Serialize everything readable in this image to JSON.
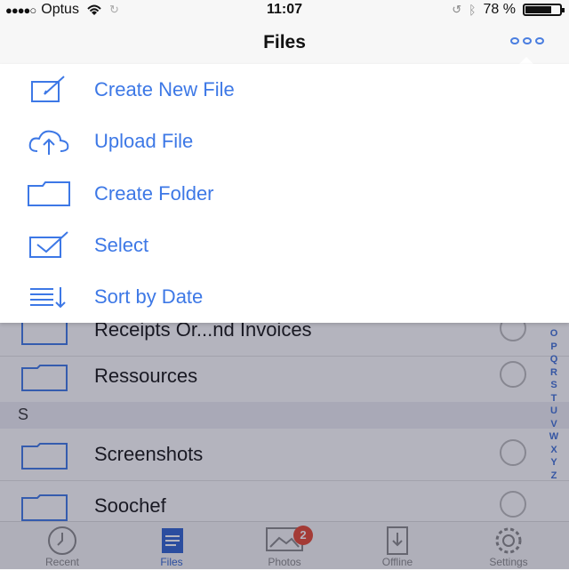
{
  "status_bar": {
    "carrier": "Optus",
    "time": "11:07",
    "battery_text": "78 %",
    "battery_level": 0.78
  },
  "nav": {
    "title": "Files",
    "more_icon": "more-icon"
  },
  "menu": {
    "items": [
      {
        "label": "Create New File",
        "icon": "compose-icon"
      },
      {
        "label": "Upload File",
        "icon": "cloud-upload-icon"
      },
      {
        "label": "Create Folder",
        "icon": "folder-icon"
      },
      {
        "label": "Select",
        "icon": "checkbox-icon"
      },
      {
        "label": "Sort by Date",
        "icon": "sort-icon"
      }
    ]
  },
  "list": {
    "rows": [
      {
        "name": "Receipts Or...nd Invoices"
      },
      {
        "name": "Ressources"
      },
      {
        "section": "S"
      },
      {
        "name": "Screenshots"
      },
      {
        "name": "Soochef"
      }
    ]
  },
  "index": [
    "O",
    "P",
    "Q",
    "R",
    "S",
    "T",
    "U",
    "V",
    "W",
    "X",
    "Y",
    "Z"
  ],
  "tabs": [
    {
      "label": "Recent",
      "icon": "clock-icon"
    },
    {
      "label": "Files",
      "icon": "files-icon",
      "active": true
    },
    {
      "label": "Photos",
      "icon": "photos-icon",
      "badge": "2"
    },
    {
      "label": "Offline",
      "icon": "offline-icon"
    },
    {
      "label": "Settings",
      "icon": "gear-icon"
    }
  ],
  "colors": {
    "accent": "#3d78e6",
    "badge": "#e7452f",
    "tab_active": "#2d62cf"
  }
}
